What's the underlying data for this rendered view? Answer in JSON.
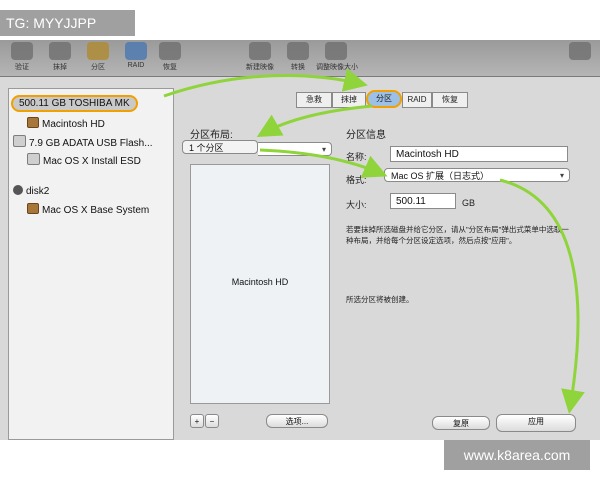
{
  "watermark": {
    "tag": "TG: MYYJJPP",
    "url": "www.k8area.com"
  },
  "toolbar": {
    "items": [
      "验证",
      "抹掉",
      "分区",
      "RAID",
      "恢复",
      "新建映像",
      "转换",
      "调整映像大小"
    ]
  },
  "sidebar": {
    "disks": [
      {
        "label": "500.11 GB TOSHIBA MK",
        "volumes": [
          "Macintosh HD"
        ]
      },
      {
        "label": "7.9 GB ADATA USB Flash...",
        "volumes": [
          "Mac OS X Install ESD"
        ]
      },
      {
        "label": "disk2",
        "volumes": [
          "Mac OS X Base System"
        ]
      }
    ]
  },
  "tabs": [
    "急救",
    "抹掉",
    "分区",
    "RAID",
    "恢复"
  ],
  "partition_layout": {
    "label": "分区布局:",
    "selected": "1 个分区",
    "map_label": "Macintosh HD"
  },
  "partition_info": {
    "label": "分区信息",
    "name_label": "名称:",
    "name_value": "Macintosh HD",
    "format_label": "格式:",
    "format_value": "Mac OS 扩展（日志式）",
    "size_label": "大小:",
    "size_value": "500.11",
    "size_unit": "GB",
    "help": "若要抹掉所选磁盘并给它分区，请从\"分区布局\"弹出式菜单中选取一种布局，并给每个分区设定选项，然后点按\"应用\"。",
    "note": "所选分区将被创建。"
  },
  "buttons": {
    "add": "+",
    "remove": "−",
    "options": "选项...",
    "revert": "复原",
    "apply": "应用"
  },
  "colors": {
    "highlight": "#f0a000",
    "arrow": "#8fd43a"
  }
}
